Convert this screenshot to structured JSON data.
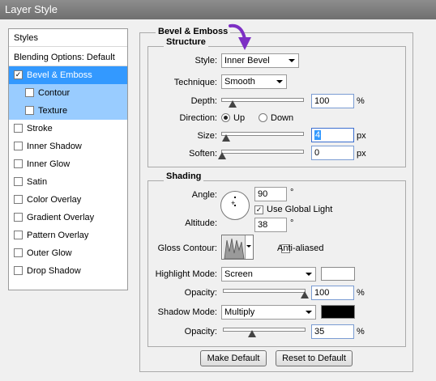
{
  "window": {
    "title": "Layer Style"
  },
  "sidebar": {
    "items": [
      {
        "label": "Styles",
        "checkbox": false,
        "checked": false
      },
      {
        "label": "Blending Options: Default",
        "checkbox": false,
        "checked": false
      },
      {
        "label": "Bevel & Emboss",
        "checkbox": true,
        "checked": true
      },
      {
        "label": "Contour",
        "checkbox": true,
        "checked": false
      },
      {
        "label": "Texture",
        "checkbox": true,
        "checked": false
      },
      {
        "label": "Stroke",
        "checkbox": true,
        "checked": false
      },
      {
        "label": "Inner Shadow",
        "checkbox": true,
        "checked": false
      },
      {
        "label": "Inner Glow",
        "checkbox": true,
        "checked": false
      },
      {
        "label": "Satin",
        "checkbox": true,
        "checked": false
      },
      {
        "label": "Color Overlay",
        "checkbox": true,
        "checked": false
      },
      {
        "label": "Gradient Overlay",
        "checkbox": true,
        "checked": false
      },
      {
        "label": "Pattern Overlay",
        "checkbox": true,
        "checked": false
      },
      {
        "label": "Outer Glow",
        "checkbox": true,
        "checked": false
      },
      {
        "label": "Drop Shadow",
        "checkbox": true,
        "checked": false
      }
    ]
  },
  "panel": {
    "title": "Bevel & Emboss",
    "structure": {
      "title": "Structure",
      "style": {
        "label": "Style:",
        "value": "Inner Bevel"
      },
      "technique": {
        "label": "Technique:",
        "value": "Smooth"
      },
      "depth": {
        "label": "Depth:",
        "value": "100",
        "unit": "%",
        "level": 0.08
      },
      "direction": {
        "label": "Direction:",
        "up": "Up",
        "down": "Down",
        "selected": "Up"
      },
      "size": {
        "label": "Size:",
        "value": "4",
        "unit": "px",
        "level": 0.02
      },
      "soften": {
        "label": "Soften:",
        "value": "0",
        "unit": "px",
        "level": 0.0
      }
    },
    "shading": {
      "title": "Shading",
      "angle": {
        "label": "Angle:",
        "value": "90",
        "unit": "°"
      },
      "global_light": {
        "label": "Use Global Light",
        "checked": true
      },
      "altitude": {
        "label": "Altitude:",
        "value": "38",
        "unit": "°"
      },
      "gloss": {
        "label": "Gloss Contour:"
      },
      "anti_aliased": {
        "label": "Anti-aliased",
        "checked": false
      },
      "highlight_mode": {
        "label": "Highlight Mode:",
        "value": "Screen",
        "color": "#ffffff"
      },
      "highlight_opacity": {
        "label": "Opacity:",
        "value": "100",
        "unit": "%",
        "level": 1.0
      },
      "shadow_mode": {
        "label": "Shadow Mode:",
        "value": "Multiply",
        "color": "#000000"
      },
      "shadow_opacity": {
        "label": "Opacity:",
        "value": "35",
        "unit": "%",
        "level": 0.35
      }
    },
    "buttons": {
      "make_default": "Make Default",
      "reset_default": "Reset to Default"
    }
  }
}
